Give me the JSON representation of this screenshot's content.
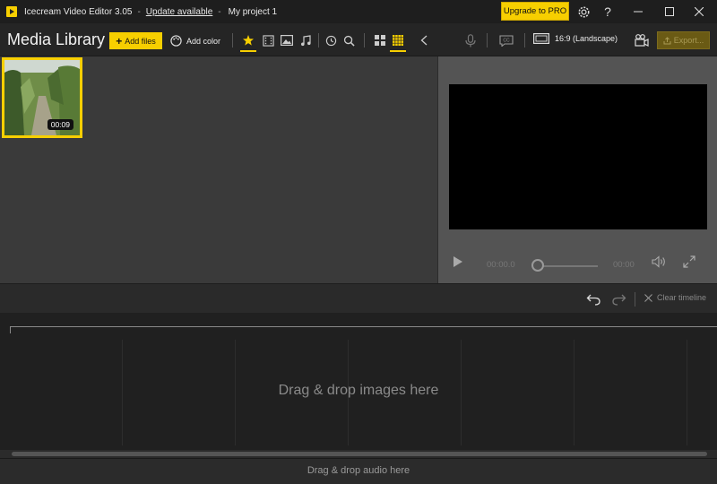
{
  "titlebar": {
    "app_name": "Icecream Video Editor 3.05",
    "separator1": "-",
    "update_link": "Update available",
    "separator2": "-",
    "project_name": "My project 1",
    "upgrade_label": "Upgrade to PRO",
    "icons": [
      "app-logo-icon",
      "gear-icon",
      "help-icon",
      "minimize-icon",
      "maximize-icon",
      "close-icon"
    ]
  },
  "toolbar": {
    "title": "Media Library",
    "add_files_label": "Add files",
    "add_color_label": "Add color",
    "filter_icons": [
      "star-icon",
      "film-icon",
      "image-icon",
      "music-icon",
      "recent-icon",
      "search-icon"
    ],
    "view_icons": [
      "grid-large-icon",
      "grid-small-icon"
    ],
    "aspect_label": "16:9 (Landscape)",
    "export_label": "Export...",
    "accent_color": "#f7cf00"
  },
  "library": {
    "items": [
      {
        "duration": "00:09"
      }
    ]
  },
  "preview": {
    "current_time": "00:00.0",
    "end_time": "00:00"
  },
  "timeline_toolbar": {
    "clear_label": "Clear timeline"
  },
  "timeline": {
    "drop_images_label": "Drag & drop images here",
    "drop_audio_label": "Drag & drop audio here"
  }
}
